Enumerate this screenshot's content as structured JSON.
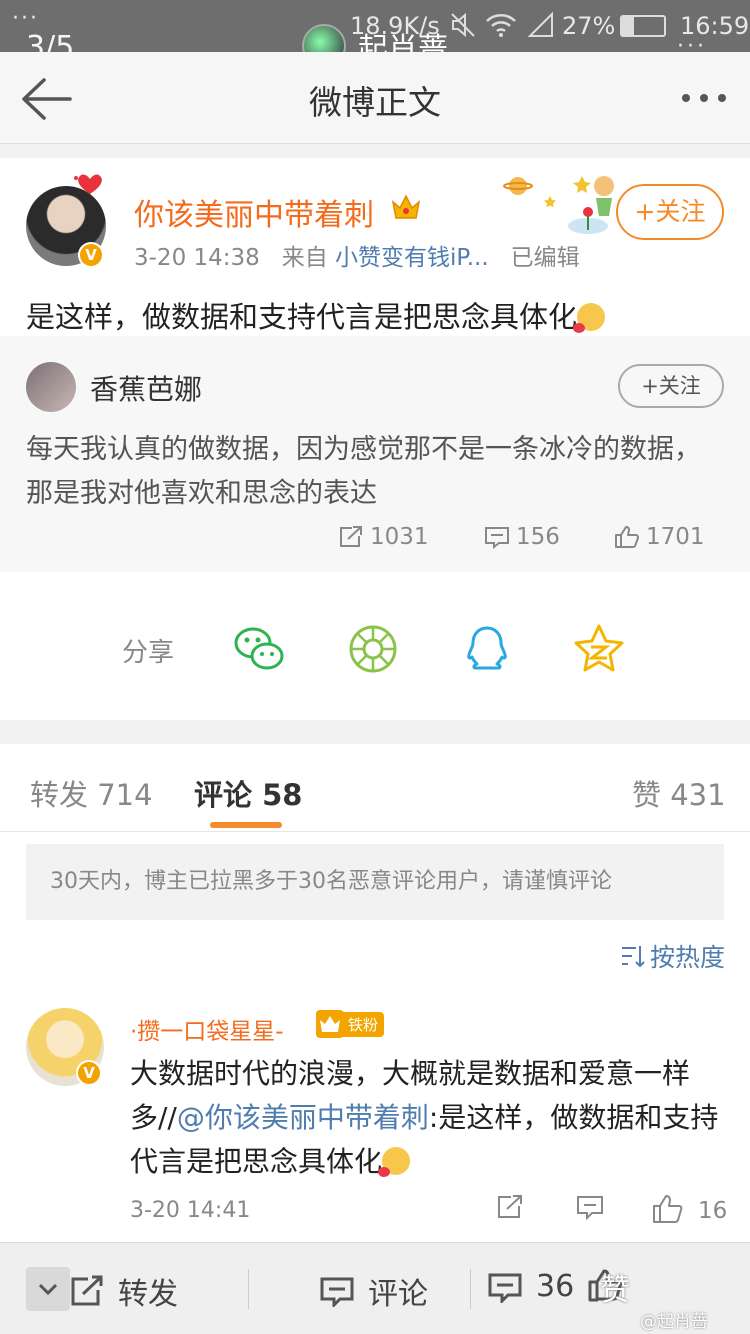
{
  "status_bar": {
    "dots": "···",
    "page_counter": "3/5",
    "overlay_username": "起肖蔷",
    "network_speed": "18.9K/s",
    "battery": "27%",
    "time": "16:59",
    "more": "···"
  },
  "topbar": {
    "title": "微博正文"
  },
  "post": {
    "author": "你该美丽中带着刺",
    "time": "3-20 14:38",
    "from_label": "来自",
    "source": "小赞变有钱iP...",
    "edited": "已编辑",
    "follow_label": "+关注",
    "text": "是这样，做数据和支持代言是把思念具体化"
  },
  "repost": {
    "author": "香蕉芭娜",
    "follow_label": "+关注",
    "text": "每天我认真的做数据，因为感觉那不是一条冰冷的数据，那是我对他喜欢和思念的表达",
    "reposts": "1031",
    "comments": "156",
    "likes": "1701"
  },
  "share": {
    "label": "分享"
  },
  "tabs": {
    "repost": "转发 714",
    "comment": "评论 58",
    "like": "赞 431"
  },
  "comments": {
    "notice": "30天内，博主已拉黑多于30名恶意评论用户，请谨慎评论",
    "sort_label": "按热度",
    "items": [
      {
        "name": "·攒一口袋星星-",
        "fan_badge": "铁粉",
        "text_before": "大数据时代的浪漫，大概就是数据和爱意一样多//",
        "mention": "@你该美丽中带着刺",
        "text_after": ":是这样，做数据和支持代言是把思念具体化",
        "time": "3-20 14:41",
        "likes": "16"
      }
    ]
  },
  "bottom_bar": {
    "repost_label": "转发",
    "comment_label": "评论",
    "comment_count": "36",
    "like_label": "赞",
    "watermark": "@起肖蔷"
  },
  "colors": {
    "accent_orange": "#f36b1d",
    "link_blue": "#507daf",
    "tab_underline": "#f58a2a"
  }
}
